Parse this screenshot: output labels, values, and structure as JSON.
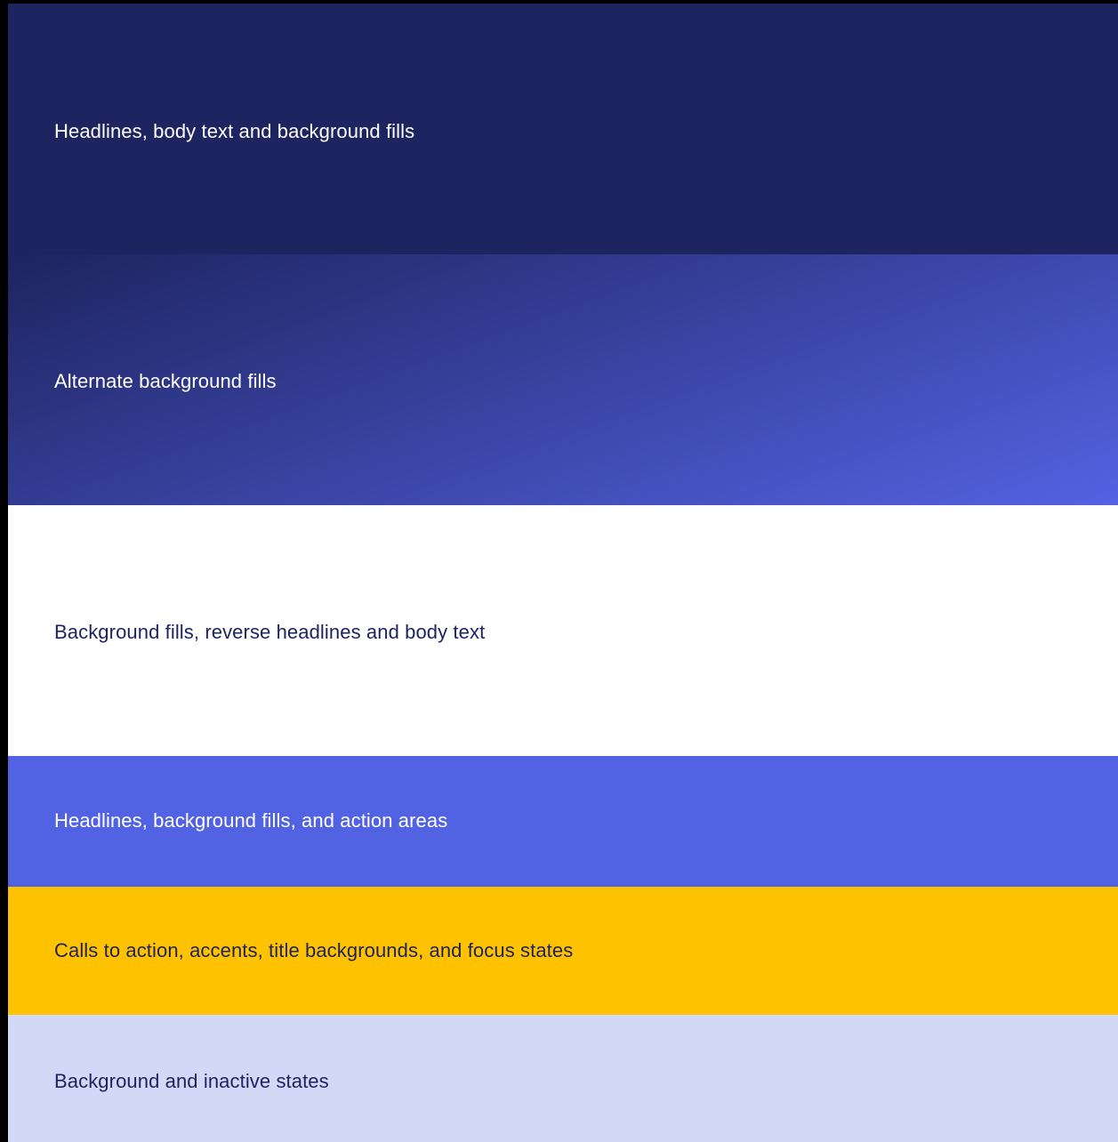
{
  "swatches": [
    {
      "label": "Headlines, body text and background fills",
      "background": "#1e2460",
      "text_color": "#ffffff"
    },
    {
      "label": "Alternate background fills",
      "background_gradient": [
        "#1e2460",
        "#5462e2"
      ],
      "text_color": "#ffffff"
    },
    {
      "label": "Background fills, reverse headlines and body text",
      "background": "#ffffff",
      "text_color": "#1e2460"
    },
    {
      "label": "Headlines, background fills, and action areas",
      "background": "#5162e3",
      "text_color": "#ffffff"
    },
    {
      "label": "Calls to action, accents, title backgrounds, and focus states",
      "background": "#ffc200",
      "text_color": "#1e2460"
    },
    {
      "label": "Background and inactive states",
      "background": "#d2d9f6",
      "text_color": "#1e2460"
    }
  ]
}
